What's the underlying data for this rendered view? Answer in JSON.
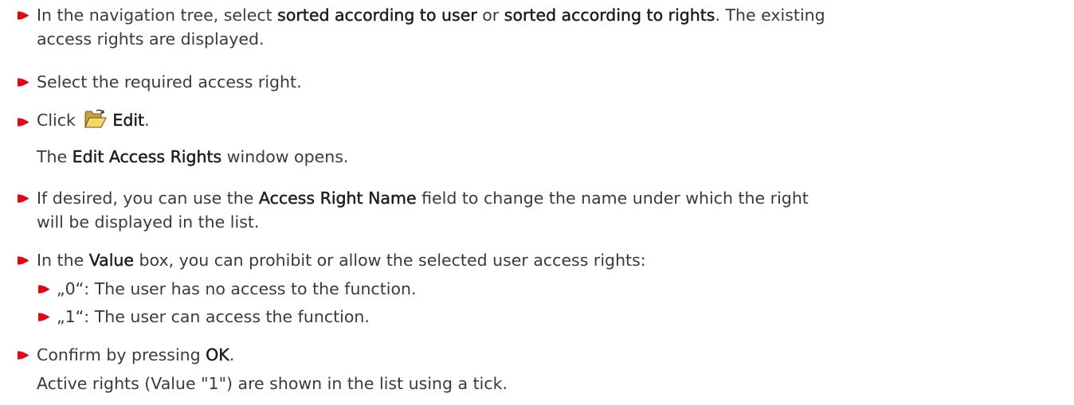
{
  "colors": {
    "bullet": "#e30613",
    "text": "#3a3a3a",
    "emphasis": "#1c1c1c"
  },
  "steps": {
    "s1": {
      "pre": "In the navigation tree, select ",
      "term1": "sorted according to user",
      "mid": " or ",
      "term2": "sorted according to rights",
      "post": ".  The existing",
      "line2": "access rights are displayed."
    },
    "s2": {
      "text": "Select the required access right."
    },
    "s3": {
      "pre": "Click ",
      "icon": "open-folder-icon",
      "term": "Edit",
      "post": ".",
      "result_pre": "The ",
      "result_term": "Edit Access Rights",
      "result_post": " window opens."
    },
    "s4": {
      "pre": "If desired, you can use the ",
      "term": "Access Right Name",
      "post": " field to change the name under which the right",
      "line2": "will be displayed in the list."
    },
    "s5": {
      "pre": "In the ",
      "term": "Value",
      "post": " box, you can prohibit or allow the selected user access rights:",
      "sub": [
        "„0“: The user has no access to the function.",
        "„1“: The user can access the function."
      ]
    },
    "s6": {
      "pre": "Confirm by pressing ",
      "term": "OK",
      "post": ".",
      "result": "Active rights (Value \"1\") are shown in the list using a tick."
    }
  }
}
